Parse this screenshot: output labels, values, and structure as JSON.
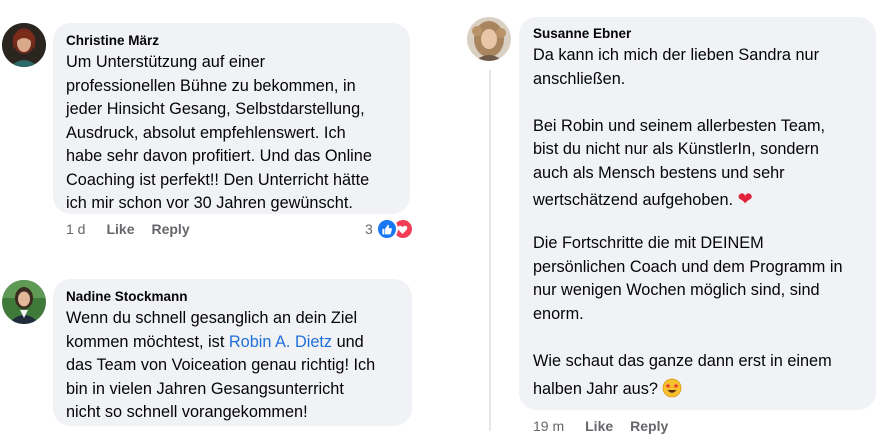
{
  "comments": [
    {
      "author": "Christine März",
      "lines": [
        "Um Unterstützung auf einer",
        "professionellen Bühne zu bekommen, in",
        "jeder Hinsicht Gesang, Selbstdarstellung,",
        "Ausdruck, absolut empfehlenswert. Ich",
        "habe sehr davon profitiert. Und das Online",
        "Coaching ist perfekt!! Den Unterricht hätte",
        "ich mir schon vor 30 Jahren gewünscht."
      ],
      "time": "1 d",
      "like": "Like",
      "reply": "Reply",
      "reaction_count": "3"
    },
    {
      "author": "Nadine Stockmann",
      "line1": "Wenn du schnell gesanglich an dein Ziel",
      "line2_before": "kommen möchtest, ist ",
      "line2_link": "Robin A. Dietz",
      "line2_after": " und",
      "line3": "das Team von Voiceation genau richtig! Ich",
      "line4": "bin in vielen Jahren Gesangsunterricht",
      "line5": "nicht so schnell vorangekommen!"
    },
    {
      "author": "Susanne Ebner",
      "p1": [
        "Da kann ich mich der lieben Sandra nur",
        "anschließen."
      ],
      "p2": [
        "Bei Robin und seinem allerbesten Team,",
        "bist du nicht nur als KünstlerIn,  sondern",
        "auch als Mensch bestens und sehr"
      ],
      "p2_last": "wertschätzend aufgehoben.",
      "p2_emoji": "❤️",
      "p3": [
        "Die Fortschritte die mit DEINEM",
        "persönlichen Coach und dem Programm in",
        "nur wenigen Wochen möglich sind, sind",
        "enorm."
      ],
      "p4": "Wie schaut das ganze dann erst in einem",
      "p4_last": "halben Jahr aus?",
      "p4_emoji": "🤩",
      "time": "19 m",
      "like": "Like",
      "reply": "Reply"
    }
  ],
  "colors": {
    "bubble": "#f0f2f5",
    "link": "#216fdb",
    "like_reaction": "#1877f2",
    "love_reaction": "#f33e58",
    "meta_text": "#65676b"
  },
  "icons": [
    "thumbs-up-icon",
    "heart-icon"
  ]
}
